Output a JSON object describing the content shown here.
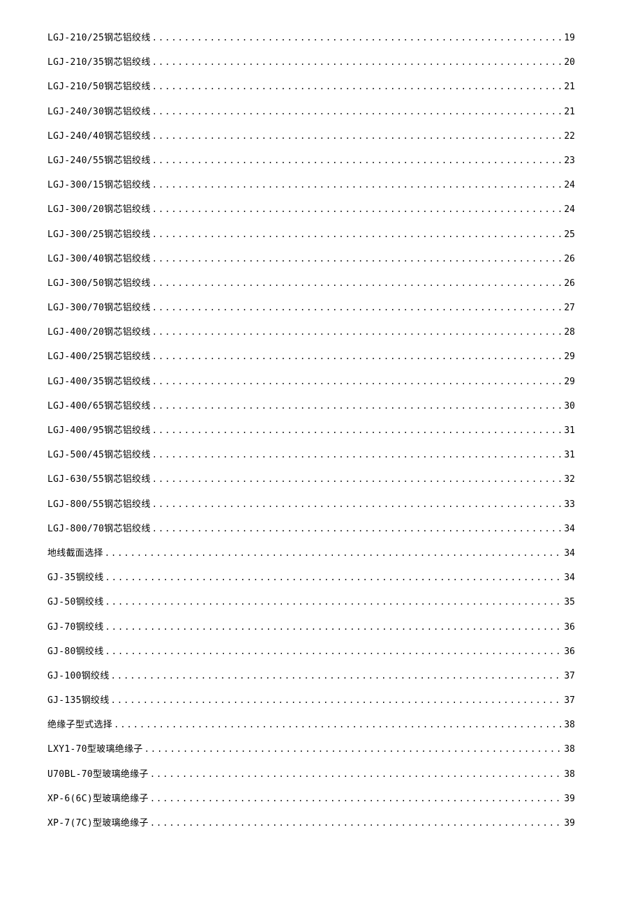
{
  "toc": {
    "entries": [
      {
        "title": "LGJ-210/25钢芯铝绞线",
        "page": "19"
      },
      {
        "title": "LGJ-210/35钢芯铝绞线",
        "page": "20"
      },
      {
        "title": "LGJ-210/50钢芯铝绞线",
        "page": "21"
      },
      {
        "title": "LGJ-240/30钢芯铝绞线",
        "page": "21"
      },
      {
        "title": "LGJ-240/40钢芯铝绞线",
        "page": "22"
      },
      {
        "title": "LGJ-240/55钢芯铝绞线",
        "page": "23"
      },
      {
        "title": "LGJ-300/15钢芯铝绞线",
        "page": "24"
      },
      {
        "title": "LGJ-300/20钢芯铝绞线",
        "page": "24"
      },
      {
        "title": "LGJ-300/25钢芯铝绞线",
        "page": "25"
      },
      {
        "title": "LGJ-300/40钢芯铝绞线",
        "page": "26"
      },
      {
        "title": "LGJ-300/50钢芯铝绞线",
        "page": "26"
      },
      {
        "title": "LGJ-300/70钢芯铝绞线",
        "page": "27"
      },
      {
        "title": "LGJ-400/20钢芯铝绞线",
        "page": "28"
      },
      {
        "title": "LGJ-400/25钢芯铝绞线",
        "page": "29"
      },
      {
        "title": "LGJ-400/35钢芯铝绞线",
        "page": "29"
      },
      {
        "title": "LGJ-400/65钢芯铝绞线",
        "page": "30"
      },
      {
        "title": "LGJ-400/95钢芯铝绞线",
        "page": "31"
      },
      {
        "title": "LGJ-500/45钢芯铝绞线",
        "page": "31"
      },
      {
        "title": "LGJ-630/55钢芯铝绞线",
        "page": "32"
      },
      {
        "title": "LGJ-800/55钢芯铝绞线",
        "page": "33"
      },
      {
        "title": "LGJ-800/70钢芯铝绞线",
        "page": "34"
      },
      {
        "title": "地线截面选择",
        "page": "34"
      },
      {
        "title": "GJ-35钢绞线",
        "page": "34"
      },
      {
        "title": "GJ-50钢绞线",
        "page": "35"
      },
      {
        "title": "GJ-70钢绞线",
        "page": "36"
      },
      {
        "title": "GJ-80钢绞线",
        "page": "36"
      },
      {
        "title": "GJ-100钢绞线",
        "page": "37"
      },
      {
        "title": "GJ-135钢绞线",
        "page": "37"
      },
      {
        "title": "绝缘子型式选择",
        "page": "38"
      },
      {
        "title": "LXY1-70型玻璃绝缘子",
        "page": "38"
      },
      {
        "title": "U70BL-70型玻璃绝缘子",
        "page": "38"
      },
      {
        "title": "XP-6(6C)型玻璃绝缘子",
        "page": " 39"
      },
      {
        "title": "XP-7(7C)型玻璃绝缘子",
        "page": " 39"
      }
    ]
  }
}
